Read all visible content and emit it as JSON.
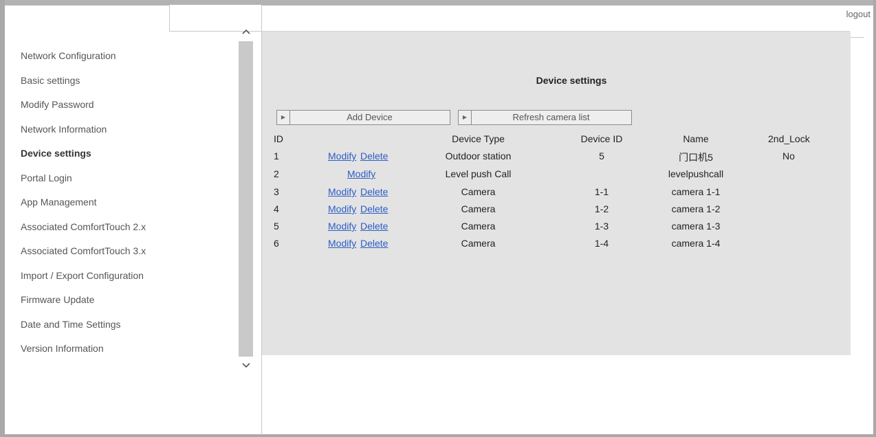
{
  "sidebar": {
    "items": [
      {
        "label": "Network Configuration",
        "name": "sidebar-item-network-configuration",
        "active": false
      },
      {
        "label": "Basic settings",
        "name": "sidebar-item-basic-settings",
        "active": false
      },
      {
        "label": "Modify Password",
        "name": "sidebar-item-modify-password",
        "active": false
      },
      {
        "label": "Network Information",
        "name": "sidebar-item-network-information",
        "active": false
      },
      {
        "label": "Device settings",
        "name": "sidebar-item-device-settings",
        "active": true
      },
      {
        "label": "Portal Login",
        "name": "sidebar-item-portal-login",
        "active": false
      },
      {
        "label": "App Management",
        "name": "sidebar-item-app-management",
        "active": false
      },
      {
        "label": "Associated ComfortTouch 2.x",
        "name": "sidebar-item-comforttouch-2x",
        "active": false
      },
      {
        "label": "Associated ComfortTouch 3.x",
        "name": "sidebar-item-comforttouch-3x",
        "active": false
      },
      {
        "label": "Import / Export Configuration",
        "name": "sidebar-item-import-export",
        "active": false
      },
      {
        "label": "Firmware Update",
        "name": "sidebar-item-firmware-update",
        "active": false
      },
      {
        "label": "Date and Time Settings",
        "name": "sidebar-item-date-time",
        "active": false
      },
      {
        "label": "Version Information",
        "name": "sidebar-item-version-information",
        "active": false
      }
    ],
    "scroll_up_icon": "chevron-up-icon",
    "scroll_down_icon": "chevron-down-icon"
  },
  "header": {
    "logout_label": "logout"
  },
  "main": {
    "title": "Device settings",
    "add_device_label": "Add Device",
    "refresh_label": "Refresh camera list",
    "columns": {
      "id": "ID",
      "device_type": "Device Type",
      "device_id": "Device ID",
      "name": "Name",
      "second_lock": "2nd_Lock"
    },
    "rows": [
      {
        "id": "1",
        "modify": "Modify",
        "delete": "Delete",
        "device_type": "Outdoor station",
        "device_id": "5",
        "name": "门口机5",
        "second_lock": "No"
      },
      {
        "id": "2",
        "modify": "Modify",
        "delete": "",
        "device_type": "Level push Call",
        "device_id": "",
        "name": "levelpushcall",
        "second_lock": ""
      },
      {
        "id": "3",
        "modify": "Modify",
        "delete": "Delete",
        "device_type": "Camera",
        "device_id": "1-1",
        "name": "camera 1-1",
        "second_lock": ""
      },
      {
        "id": "4",
        "modify": "Modify",
        "delete": "Delete",
        "device_type": "Camera",
        "device_id": "1-2",
        "name": "camera 1-2",
        "second_lock": ""
      },
      {
        "id": "5",
        "modify": "Modify",
        "delete": "Delete",
        "device_type": "Camera",
        "device_id": "1-3",
        "name": "camera 1-3",
        "second_lock": ""
      },
      {
        "id": "6",
        "modify": "Modify",
        "delete": "Delete",
        "device_type": "Camera",
        "device_id": "1-4",
        "name": "camera 1-4",
        "second_lock": ""
      }
    ],
    "link_color": "#2c5cc5",
    "panel_color": "#e3e3e3"
  }
}
